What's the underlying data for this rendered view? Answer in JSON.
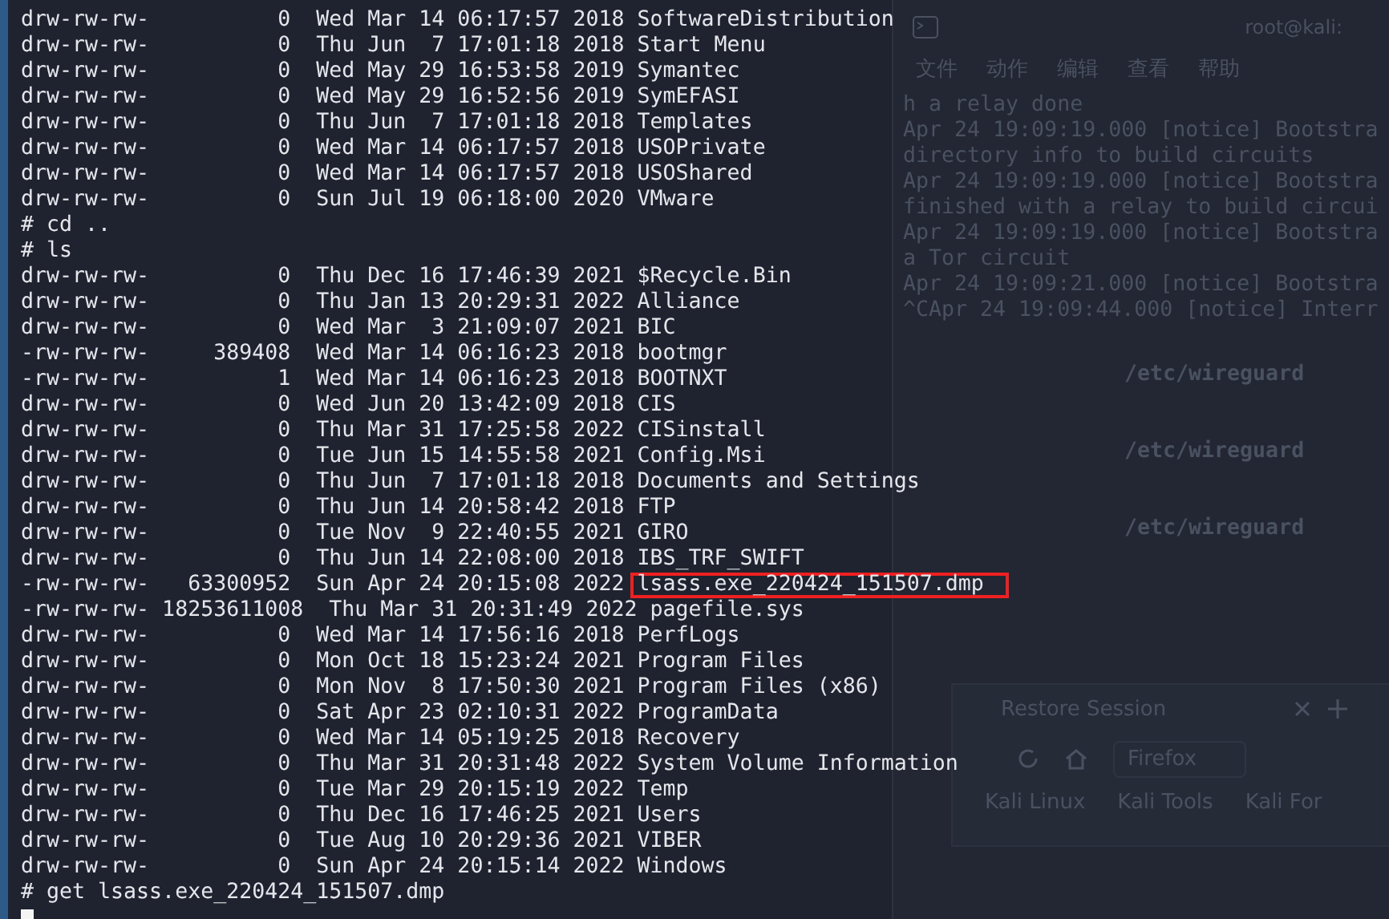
{
  "background_window": {
    "title": "root@kali:",
    "menu": [
      "文件",
      "动作",
      "编辑",
      "查看",
      "帮助"
    ],
    "log_lines": [
      "h a relay done",
      "Apr 24 19:09:19.000 [notice] Bootstra",
      "directory info to build circuits",
      "Apr 24 19:09:19.000 [notice] Bootstra",
      "finished with a relay to build circui",
      "Apr 24 19:09:19.000 [notice] Bootstra",
      "a Tor circuit",
      "Apr 24 19:09:21.000 [notice] Bootstra",
      "^CApr 24 19:09:44.000 [notice] Interr"
    ],
    "prompts": [
      "/etc/wireguard",
      "/etc/wireguard",
      "/etc/wireguard"
    ],
    "browser": {
      "tab": "Restore Session",
      "address": "Firefox",
      "bookmarks": [
        "Kali Linux",
        "Kali Tools",
        "Kali For"
      ]
    }
  },
  "lines": [
    {
      "kind": "entry",
      "perms": "drw-rw-rw-",
      "size": "0",
      "date": "Wed Mar 14 06:17:57 2018",
      "name": "SoftwareDistribution",
      "highlighted": false
    },
    {
      "kind": "entry",
      "perms": "drw-rw-rw-",
      "size": "0",
      "date": "Thu Jun  7 17:01:18 2018",
      "name": "Start Menu",
      "highlighted": false
    },
    {
      "kind": "entry",
      "perms": "drw-rw-rw-",
      "size": "0",
      "date": "Wed May 29 16:53:58 2019",
      "name": "Symantec",
      "highlighted": false
    },
    {
      "kind": "entry",
      "perms": "drw-rw-rw-",
      "size": "0",
      "date": "Wed May 29 16:52:56 2019",
      "name": "SymEFASI",
      "highlighted": false
    },
    {
      "kind": "entry",
      "perms": "drw-rw-rw-",
      "size": "0",
      "date": "Thu Jun  7 17:01:18 2018",
      "name": "Templates",
      "highlighted": false
    },
    {
      "kind": "entry",
      "perms": "drw-rw-rw-",
      "size": "0",
      "date": "Wed Mar 14 06:17:57 2018",
      "name": "USOPrivate",
      "highlighted": false
    },
    {
      "kind": "entry",
      "perms": "drw-rw-rw-",
      "size": "0",
      "date": "Wed Mar 14 06:17:57 2018",
      "name": "USOShared",
      "highlighted": false
    },
    {
      "kind": "entry",
      "perms": "drw-rw-rw-",
      "size": "0",
      "date": "Sun Jul 19 06:18:00 2020",
      "name": "VMware",
      "highlighted": false
    },
    {
      "kind": "command",
      "text": "# cd .."
    },
    {
      "kind": "command",
      "text": "# ls"
    },
    {
      "kind": "entry",
      "perms": "drw-rw-rw-",
      "size": "0",
      "date": "Thu Dec 16 17:46:39 2021",
      "name": "$Recycle.Bin",
      "highlighted": false
    },
    {
      "kind": "entry",
      "perms": "drw-rw-rw-",
      "size": "0",
      "date": "Thu Jan 13 20:29:31 2022",
      "name": "Alliance",
      "highlighted": false
    },
    {
      "kind": "entry",
      "perms": "drw-rw-rw-",
      "size": "0",
      "date": "Wed Mar  3 21:09:07 2021",
      "name": "BIC",
      "highlighted": false
    },
    {
      "kind": "entry",
      "perms": "-rw-rw-rw-",
      "size": "389408",
      "date": "Wed Mar 14 06:16:23 2018",
      "name": "bootmgr",
      "highlighted": false
    },
    {
      "kind": "entry",
      "perms": "-rw-rw-rw-",
      "size": "1",
      "date": "Wed Mar 14 06:16:23 2018",
      "name": "BOOTNXT",
      "highlighted": false
    },
    {
      "kind": "entry",
      "perms": "drw-rw-rw-",
      "size": "0",
      "date": "Wed Jun 20 13:42:09 2018",
      "name": "CIS",
      "highlighted": false
    },
    {
      "kind": "entry",
      "perms": "drw-rw-rw-",
      "size": "0",
      "date": "Thu Mar 31 17:25:58 2022",
      "name": "CISinstall",
      "highlighted": false
    },
    {
      "kind": "entry",
      "perms": "drw-rw-rw-",
      "size": "0",
      "date": "Tue Jun 15 14:55:58 2021",
      "name": "Config.Msi",
      "highlighted": false
    },
    {
      "kind": "entry",
      "perms": "drw-rw-rw-",
      "size": "0",
      "date": "Thu Jun  7 17:01:18 2018",
      "name": "Documents and Settings",
      "highlighted": false
    },
    {
      "kind": "entry",
      "perms": "drw-rw-rw-",
      "size": "0",
      "date": "Thu Jun 14 20:58:42 2018",
      "name": "FTP",
      "highlighted": false
    },
    {
      "kind": "entry",
      "perms": "drw-rw-rw-",
      "size": "0",
      "date": "Tue Nov  9 22:40:55 2021",
      "name": "GIRO",
      "highlighted": false
    },
    {
      "kind": "entry",
      "perms": "drw-rw-rw-",
      "size": "0",
      "date": "Thu Jun 14 22:08:00 2018",
      "name": "IBS_TRF_SWIFT",
      "highlighted": false
    },
    {
      "kind": "entry",
      "perms": "-rw-rw-rw-",
      "size": "63300952",
      "date": "Sun Apr 24 20:15:08 2022",
      "name": "lsass.exe_220424_151507.dmp",
      "highlighted": true
    },
    {
      "kind": "entry",
      "perms": "-rw-rw-rw-",
      "size": "18253611008",
      "date": "Thu Mar 31 20:31:49 2022",
      "name": "pagefile.sys",
      "highlighted": false
    },
    {
      "kind": "entry",
      "perms": "drw-rw-rw-",
      "size": "0",
      "date": "Wed Mar 14 17:56:16 2018",
      "name": "PerfLogs",
      "highlighted": false
    },
    {
      "kind": "entry",
      "perms": "drw-rw-rw-",
      "size": "0",
      "date": "Mon Oct 18 15:23:24 2021",
      "name": "Program Files",
      "highlighted": false
    },
    {
      "kind": "entry",
      "perms": "drw-rw-rw-",
      "size": "0",
      "date": "Mon Nov  8 17:50:30 2021",
      "name": "Program Files (x86)",
      "highlighted": false
    },
    {
      "kind": "entry",
      "perms": "drw-rw-rw-",
      "size": "0",
      "date": "Sat Apr 23 02:10:31 2022",
      "name": "ProgramData",
      "highlighted": false
    },
    {
      "kind": "entry",
      "perms": "drw-rw-rw-",
      "size": "0",
      "date": "Wed Mar 14 05:19:25 2018",
      "name": "Recovery",
      "highlighted": false
    },
    {
      "kind": "entry",
      "perms": "drw-rw-rw-",
      "size": "0",
      "date": "Thu Mar 31 20:31:48 2022",
      "name": "System Volume Information",
      "highlighted": false
    },
    {
      "kind": "entry",
      "perms": "drw-rw-rw-",
      "size": "0",
      "date": "Tue Mar 29 20:15:19 2022",
      "name": "Temp",
      "highlighted": false
    },
    {
      "kind": "entry",
      "perms": "drw-rw-rw-",
      "size": "0",
      "date": "Thu Dec 16 17:46:25 2021",
      "name": "Users",
      "highlighted": false
    },
    {
      "kind": "entry",
      "perms": "drw-rw-rw-",
      "size": "0",
      "date": "Tue Aug 10 20:29:36 2021",
      "name": "VIBER",
      "highlighted": false
    },
    {
      "kind": "entry",
      "perms": "drw-rw-rw-",
      "size": "0",
      "date": "Sun Apr 24 20:15:14 2022",
      "name": "Windows",
      "highlighted": false
    },
    {
      "kind": "command",
      "text": "# get lsass.exe_220424_151507.dmp"
    },
    {
      "kind": "cursor"
    }
  ]
}
